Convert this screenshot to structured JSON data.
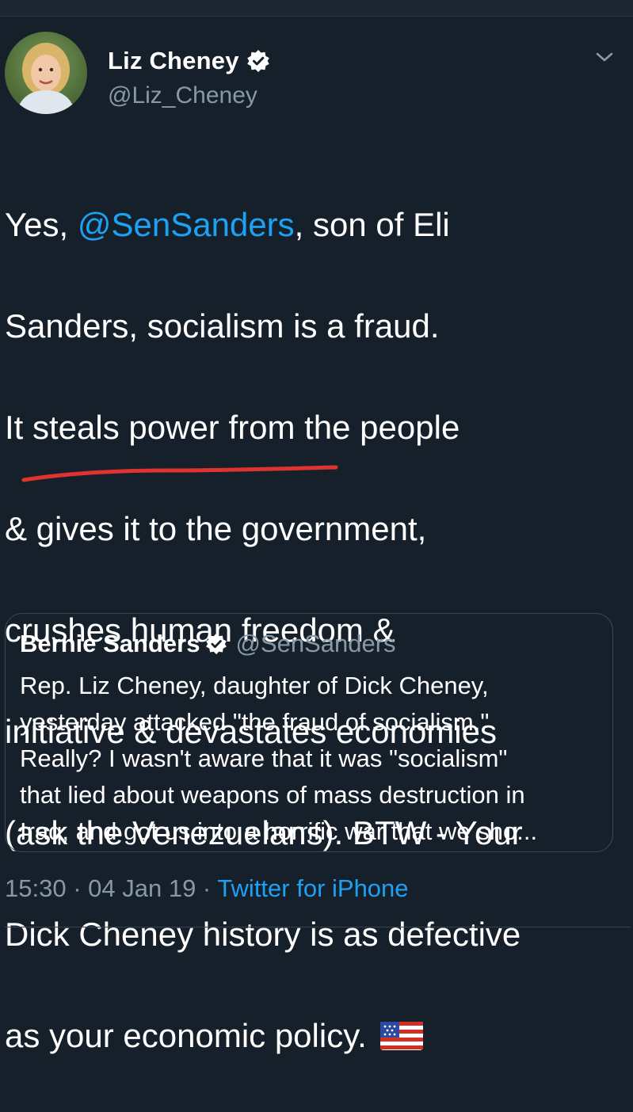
{
  "author": {
    "display_name": "Liz Cheney",
    "handle": "@Liz_Cheney",
    "avatar_icon": "profile-photo-icon",
    "verified_icon": "verified-badge-icon"
  },
  "tweet": {
    "lines": [
      {
        "mention": "",
        "pre": "Yes, ",
        "mention_text": "@SenSanders",
        "post": ", son of Eli"
      },
      {
        "text": "Sanders, socialism is a fraud."
      },
      {
        "text": "It steals power from the people"
      },
      {
        "text": "& gives it to the government,"
      },
      {
        "text": "crushes human freedom &"
      },
      {
        "text": "initiative & devastates economies"
      },
      {
        "text": "(ask the Venezuelans). BTW - Your"
      },
      {
        "text": "Dick Cheney history is as defective"
      },
      {
        "text": "as your economic policy."
      }
    ],
    "emoji_icon": "us-flag-icon"
  },
  "quoted_tweet": {
    "display_name": "Bernie Sanders",
    "handle": "@SenSanders",
    "lines": [
      "Rep. Liz Cheney, daughter of Dick Cheney,",
      "yesterday attacked \"the fraud of socialism.\"",
      "Really? I wasn't aware that it was \"socialism\"",
      "that lied about weapons of mass destruction in",
      "Iraq, and got us into a horrific war that we sho..."
    ]
  },
  "meta": {
    "time": "15:30",
    "separator": " · ",
    "date": "04 Jan 19",
    "source": "Twitter for iPhone"
  },
  "colors": {
    "background": "#15202b",
    "mention": "#1da1f2",
    "secondary_text": "#8899a6",
    "annotation_underline": "#e0322e"
  }
}
